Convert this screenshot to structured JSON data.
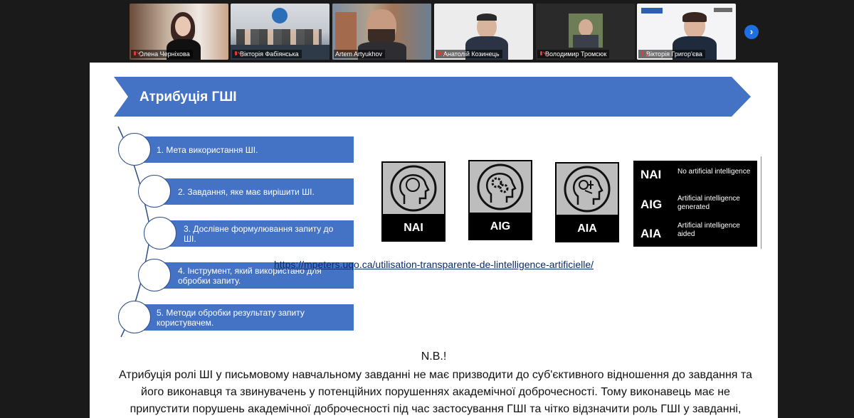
{
  "participants": [
    {
      "name": "Олена Черніхова",
      "active": false
    },
    {
      "name": "Вікторія Фабіянська",
      "active": false
    },
    {
      "name": "Artem Artyukhov",
      "active": true
    },
    {
      "name": "Анатолій Козинець",
      "active": false
    },
    {
      "name": "Володимир Тромсюк",
      "active": false
    },
    {
      "name": "Вікторія Григор'єва",
      "active": false
    }
  ],
  "next_label": "›",
  "slide": {
    "title": "Атрибуція ГШІ",
    "items": [
      "1. Мета використання ШІ.",
      "2. Завдання, яке має вирішити ШІ.",
      "3. Дослівне формулювання запиту до ШІ.",
      "4. Інструмент, який використано для обробки запиту.",
      "5. Методи обробки результату запиту користувачем."
    ],
    "icons": [
      "NAI",
      "AIG",
      "AIA"
    ],
    "legend": [
      {
        "code": "NAI",
        "desc": "No artificial intelligence"
      },
      {
        "code": "AIG",
        "desc": "Artificial intelligence generated"
      },
      {
        "code": "AIA",
        "desc": "Artificial intelligence aided"
      }
    ],
    "link": "https://mpeters.uqo.ca/utilisation-transparente-de-lintelligence-artificielle/",
    "nb": "N.B.!",
    "paragraph": "Атрибуція ролі ШІ у письмовому навчальному завданні не має призводити до суб'єктивного відношення до завдання та його виконавця та звинувачень у потенційних порушеннях академічної доброчесності. Тому виконавець має не припустити порушень академічної доброчесності під час застосування ГШІ та чітко відзначити роль ГШІ у завданні,"
  },
  "colors": {
    "accent_blue": "#4472c4",
    "active_outline": "#3fd27a",
    "mic_muted": "#e03a3a"
  }
}
